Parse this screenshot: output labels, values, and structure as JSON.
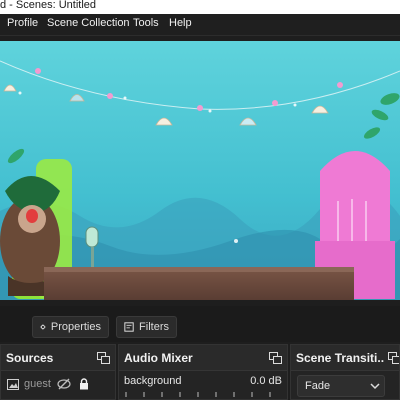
{
  "window": {
    "title": "d - Scenes: Untitled"
  },
  "menu": {
    "items": [
      "Profile",
      "Scene Collection",
      "Tools",
      "Help"
    ]
  },
  "toolbar": {
    "properties_label": "Properties",
    "filters_label": "Filters"
  },
  "sources": {
    "title": "Sources",
    "items": [
      {
        "label": "guest c"
      }
    ]
  },
  "audio_mixer": {
    "title": "Audio Mixer",
    "tracks": [
      {
        "name": "background",
        "level": "0.0 dB"
      }
    ]
  },
  "transitions": {
    "title": "Scene Transiti...",
    "selected": "Fade"
  },
  "colors": {
    "sky": "#46c2d3",
    "table": "#6a4a3d",
    "green_chair": "#8de23b",
    "pink_chair": "#ef7ad4",
    "accent": "#dcdcdc"
  },
  "icons": [
    "gear-icon",
    "filter-icon",
    "float-dock-icon",
    "image-source-icon",
    "visibility-off-icon",
    "lock-icon",
    "chevron-down-icon"
  ]
}
